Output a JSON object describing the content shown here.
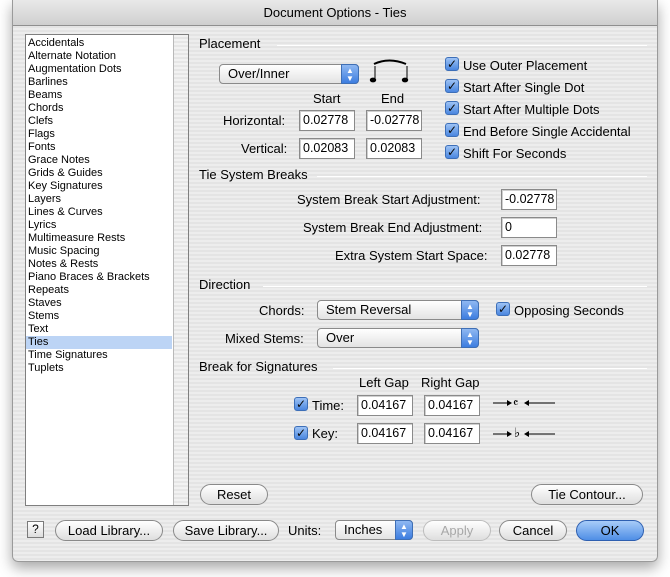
{
  "window": {
    "title": "Document Options - Ties"
  },
  "sidebar": {
    "items": [
      {
        "label": "Accidentals"
      },
      {
        "label": "Alternate Notation"
      },
      {
        "label": "Augmentation Dots"
      },
      {
        "label": "Barlines"
      },
      {
        "label": "Beams"
      },
      {
        "label": "Chords"
      },
      {
        "label": "Clefs"
      },
      {
        "label": "Flags"
      },
      {
        "label": "Fonts"
      },
      {
        "label": "Grace Notes"
      },
      {
        "label": "Grids & Guides"
      },
      {
        "label": "Key Signatures"
      },
      {
        "label": "Layers"
      },
      {
        "label": "Lines & Curves"
      },
      {
        "label": "Lyrics"
      },
      {
        "label": "Multimeasure Rests"
      },
      {
        "label": "Music Spacing"
      },
      {
        "label": "Notes & Rests"
      },
      {
        "label": "Piano Braces & Brackets"
      },
      {
        "label": "Repeats"
      },
      {
        "label": "Staves"
      },
      {
        "label": "Stems"
      },
      {
        "label": "Text"
      },
      {
        "label": "Ties"
      },
      {
        "label": "Time Signatures"
      },
      {
        "label": "Tuplets"
      }
    ],
    "selected": "Ties"
  },
  "placement": {
    "heading": "Placement",
    "popup_value": "Over/Inner",
    "col_start": "Start",
    "col_end": "End",
    "horizontal_label": "Horizontal:",
    "horizontal_start": "0.02778",
    "horizontal_end": "-0.02778",
    "vertical_label": "Vertical:",
    "vertical_start": "0.02083",
    "vertical_end": "0.02083",
    "checkboxes": {
      "use_outer": "Use Outer Placement",
      "after_single_dot": "Start After Single Dot",
      "after_multiple_dots": "Start After Multiple Dots",
      "before_accidental": "End Before Single Accidental",
      "shift_seconds": "Shift For Seconds"
    }
  },
  "breaks": {
    "heading": "Tie System Breaks",
    "start_label": "System Break Start Adjustment:",
    "start_value": "-0.02778",
    "end_label": "System Break End Adjustment:",
    "end_value": "0",
    "extra_label": "Extra System Start Space:",
    "extra_value": "0.02778"
  },
  "direction": {
    "heading": "Direction",
    "chords_label": "Chords:",
    "chords_value": "Stem Reversal",
    "opposing_label": "Opposing Seconds",
    "mixed_label": "Mixed Stems:",
    "mixed_value": "Over"
  },
  "signatures": {
    "heading": "Break for Signatures",
    "left_gap": "Left Gap",
    "right_gap": "Right Gap",
    "time_label": "Time:",
    "time_left": "0.04167",
    "time_right": "0.04167",
    "key_label": "Key:",
    "key_left": "0.04167",
    "key_right": "0.04167"
  },
  "buttons": {
    "reset": "Reset",
    "tie_contour": "Tie Contour...",
    "help": "?",
    "load_library": "Load Library...",
    "save_library": "Save Library...",
    "units_label": "Units:",
    "units_value": "Inches",
    "apply": "Apply",
    "cancel": "Cancel",
    "ok": "OK"
  },
  "colors": {
    "accent": "#4a86df",
    "selection": "#bcd4f5"
  }
}
